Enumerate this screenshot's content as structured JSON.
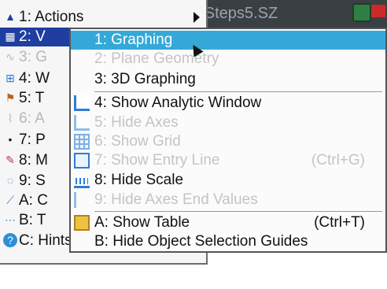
{
  "topbar": {
    "status": "*Steps5.SZ"
  },
  "left_menu": {
    "items": [
      {
        "label": "1: Actions",
        "icon": "cursor-icon",
        "state": "normal"
      },
      {
        "label": "2: V",
        "icon": "view-icon",
        "state": "selected"
      },
      {
        "label": "3: G",
        "icon": "graph-type-icon",
        "state": "dim"
      },
      {
        "label": "4: W",
        "icon": "window-icon",
        "state": "normal"
      },
      {
        "label": "5: T",
        "icon": "trace-icon",
        "state": "normal"
      },
      {
        "label": "6: A",
        "icon": "analyze-icon",
        "state": "dim"
      },
      {
        "label": "7: P",
        "icon": "points-icon",
        "state": "normal"
      },
      {
        "label": "8: M",
        "icon": "measure-icon",
        "state": "normal"
      },
      {
        "label": "9: S",
        "icon": "shapes-icon",
        "state": "normal"
      },
      {
        "label": "A: C",
        "icon": "construct-icon",
        "state": "normal"
      },
      {
        "label": "B: T",
        "icon": "transform-icon",
        "state": "normal"
      },
      {
        "label": "C: Hints",
        "icon": "hint-icon",
        "state": "normal"
      }
    ]
  },
  "submenu": {
    "items": [
      {
        "label": "1: Graphing",
        "icon": "",
        "state": "selected",
        "shortcut": ""
      },
      {
        "label": "2: Plane Geometry",
        "icon": "",
        "state": "dim",
        "shortcut": ""
      },
      {
        "label": "3: 3D Graphing",
        "icon": "",
        "state": "normal",
        "shortcut": ""
      },
      {
        "label": "4: Show Analytic Window",
        "icon": "axes-icon",
        "state": "normal",
        "shortcut": ""
      },
      {
        "label": "5: Hide Axes",
        "icon": "hide-axes-icon",
        "state": "dim",
        "shortcut": ""
      },
      {
        "label": "6: Show Grid",
        "icon": "grid-icon",
        "state": "dim",
        "shortcut": ""
      },
      {
        "label": "7: Show Entry Line",
        "icon": "entry-line-icon",
        "state": "dim",
        "shortcut": "(Ctrl+G)"
      },
      {
        "label": "8: Hide Scale",
        "icon": "scale-icon",
        "state": "normal",
        "shortcut": ""
      },
      {
        "label": "9: Hide Axes End Values",
        "icon": "axes-end-values-icon",
        "state": "dim",
        "shortcut": ""
      },
      {
        "label": "A: Show Table",
        "icon": "table-icon",
        "state": "normal",
        "shortcut": "(Ctrl+T)"
      },
      {
        "label": "B: Hide Object Selection Guides",
        "icon": "",
        "state": "normal",
        "shortcut": ""
      }
    ]
  }
}
